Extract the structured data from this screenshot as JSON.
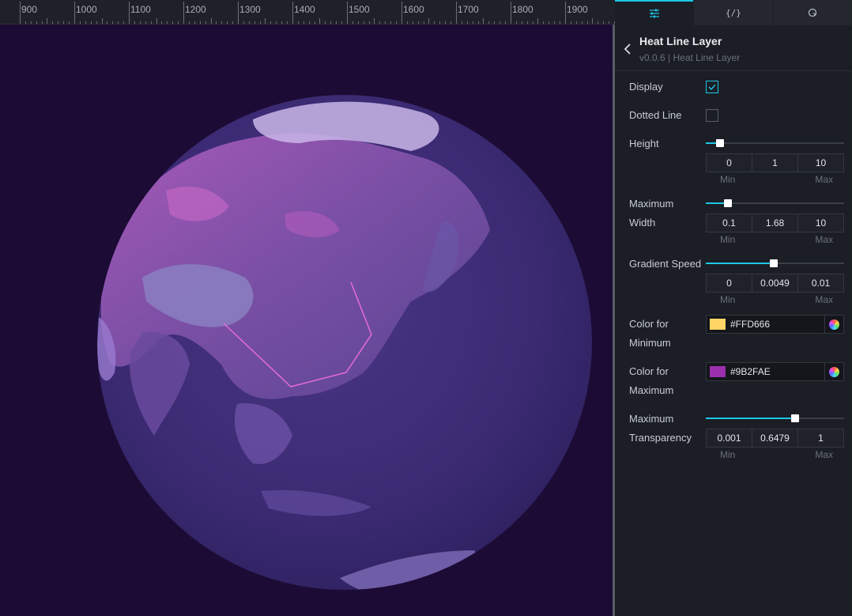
{
  "ruler": {
    "labels": [
      "900",
      "1000",
      "1100",
      "1200",
      "1300",
      "1400",
      "1500",
      "1600",
      "1700",
      "1800",
      "1900"
    ]
  },
  "tabs": [
    {
      "name": "settings-tab",
      "icon": "sliders-icon"
    },
    {
      "name": "data-tab",
      "icon": "code-icon",
      "label": "{/}"
    },
    {
      "name": "interaction-tab",
      "icon": "interaction-icon"
    }
  ],
  "header": {
    "title": "Heat Line Layer",
    "subtitle": "v0.0.6 | Heat Line Layer"
  },
  "settings": {
    "display": {
      "label": "Display",
      "checked": true
    },
    "dotted_line": {
      "label": "Dotted Line",
      "checked": false
    },
    "height": {
      "label": "Height",
      "min": "0",
      "value": "1",
      "max": "10",
      "fraction": 0.1
    },
    "max_width": {
      "label1": "Maximum",
      "label2": "Width",
      "min": "0.1",
      "value": "1.68",
      "max": "10",
      "fraction": 0.16
    },
    "gradient_speed": {
      "label": "Gradient Speed",
      "min": "0",
      "value": "0.0049",
      "max": "0.01",
      "fraction": 0.49
    },
    "color_min": {
      "label1": "Color for",
      "label2": "Minimum",
      "hex": "#FFD666",
      "color": "#FFD666"
    },
    "color_max": {
      "label1": "Color for",
      "label2": "Maximum",
      "hex": "#9B2FAE",
      "color": "#9B2FAE"
    },
    "max_transparency": {
      "label1": "Maximum",
      "label2": "Transparency",
      "min": "0.001",
      "value": "0.6479",
      "max": "1",
      "fraction": 0.648
    },
    "min_caption": "Min",
    "max_caption": "Max"
  },
  "colors": {
    "accent": "#1EC7E6",
    "canvas_bg": "#1C0B34",
    "heat_line": "#E86BD8"
  }
}
